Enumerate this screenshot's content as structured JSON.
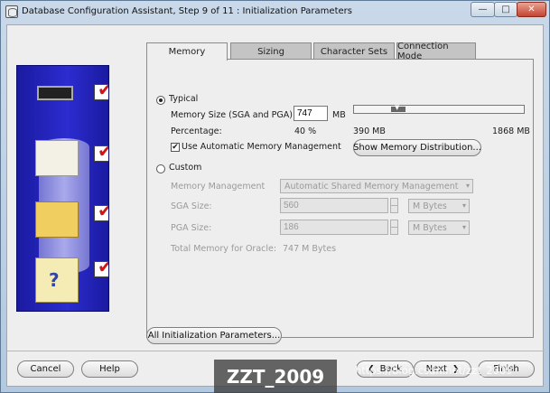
{
  "window": {
    "title": "Database Configuration Assistant, Step 9 of 11 : Initialization Parameters",
    "minimize_label": "—",
    "maximize_label": "□",
    "close_label": "✕"
  },
  "tabs": [
    {
      "label": "Memory",
      "active": true
    },
    {
      "label": "Sizing",
      "active": false
    },
    {
      "label": "Character Sets",
      "active": false
    },
    {
      "label": "Connection Mode",
      "active": false
    }
  ],
  "memory": {
    "typical_label": "Typical",
    "typical_selected": true,
    "memory_size_label": "Memory Size (SGA and PGA):",
    "memory_size_value": "747",
    "memory_size_unit": "MB",
    "percentage_label": "Percentage:",
    "percentage_value": "40 %",
    "slider_min_label": "390 MB",
    "slider_max_label": "1868 MB",
    "slider_fraction": 0.24,
    "amm_label": "Use Automatic Memory Management",
    "amm_checked": true,
    "amm_check_glyph": "✔",
    "show_distribution_button": "Show Memory Distribution...",
    "custom_label": "Custom",
    "custom_selected": false,
    "memory_management_label": "Memory Management",
    "memory_management_value": "Automatic Shared Memory Management",
    "sga_label": "SGA Size:",
    "sga_value": "560",
    "sga_unit": "M Bytes",
    "pga_label": "PGA Size:",
    "pga_value": "186",
    "pga_unit": "M Bytes",
    "total_label": "Total Memory for Oracle:",
    "total_value": "747 M Bytes"
  },
  "all_params_button": "All Initialization Parameters...",
  "footer": {
    "cancel": "Cancel",
    "help": "Help",
    "back": "Back",
    "next": "Next",
    "finish": "Finish"
  },
  "watermark": {
    "text": "ZZT_2009",
    "url": "https://blog.csdn.net/zzt_2009"
  },
  "icons": {
    "chevron": "▾",
    "back_arrow": "❮",
    "next_arrow": "❯",
    "question": "?"
  }
}
